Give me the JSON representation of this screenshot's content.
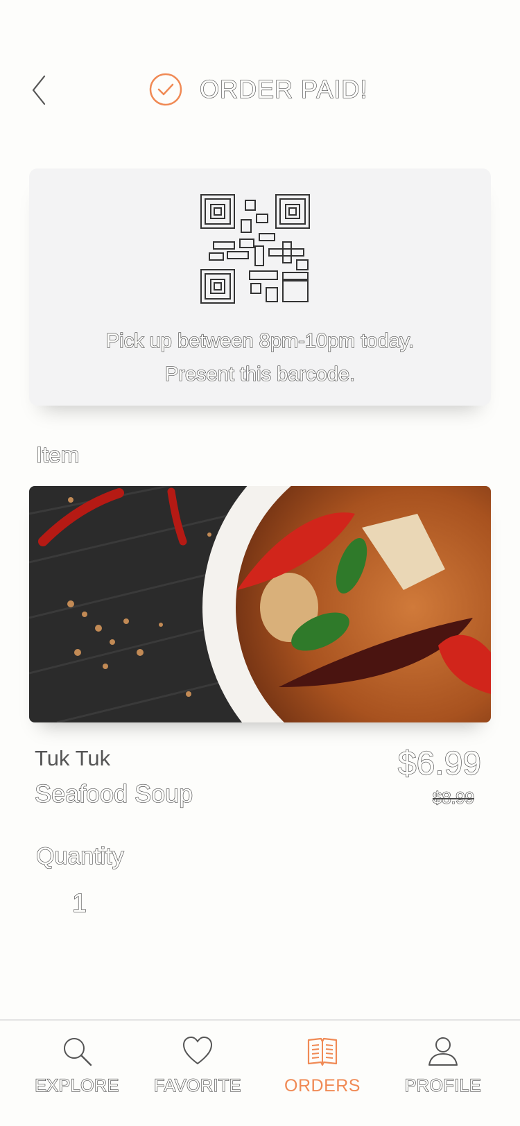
{
  "header": {
    "title": "ORDER PAID!"
  },
  "pickup": {
    "line1": "Pick up between 8pm-10pm today.",
    "line2": "Present this barcode."
  },
  "item": {
    "section_label": "Item",
    "restaurant": "Tuk Tuk",
    "name": "Seafood Soup",
    "price": "$6.99",
    "original_price": "$8.99"
  },
  "quantity": {
    "label": "Quantity",
    "value": "1"
  },
  "tabs": [
    {
      "label": "EXPLORE",
      "icon": "search-icon"
    },
    {
      "label": "FAVORITE",
      "icon": "heart-icon"
    },
    {
      "label": "ORDERS",
      "icon": "book-icon",
      "active": true
    },
    {
      "label": "PROFILE",
      "icon": "user-icon"
    }
  ],
  "colors": {
    "accent": "#f08a55",
    "text": "#4a4a4a",
    "card": "#f3f3f4"
  }
}
